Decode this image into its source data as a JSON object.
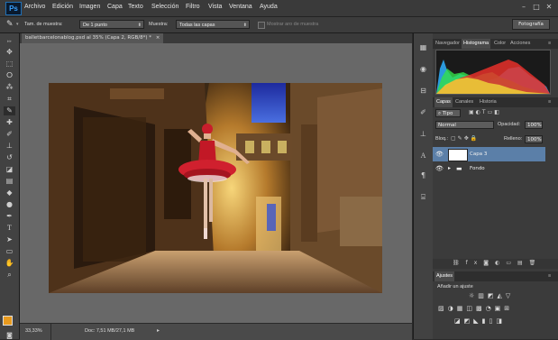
{
  "app": {
    "logo": "Ps"
  },
  "menu": [
    "Archivo",
    "Edición",
    "Imagen",
    "Capa",
    "Texto",
    "Selección",
    "Filtro",
    "Vista",
    "Ventana",
    "Ayuda"
  ],
  "window_controls": {
    "minimize": "–",
    "maximize": "□",
    "close": "✕"
  },
  "options_bar": {
    "sample_size_label": "Tam. de muestra:",
    "sample_size_value": "De 1 punto",
    "sample_label": "Muestra:",
    "sample_value": "Todas las capas",
    "show_ring_label": "Mostrar aro de muestra",
    "workspace": "Fotografía"
  },
  "document": {
    "tab_title": "balletbarcelonablog.psd al 35% (Capa 2, RGB/8*) *",
    "tab_close": "×",
    "zoom": "33,33%",
    "doc_info": "Doc: 7,51 MB/27,1 MB"
  },
  "panels": {
    "top_tabs": [
      "Navegador",
      "Histograma",
      "Color",
      "Acciones"
    ],
    "top_active": "Histograma",
    "layers_tabs": [
      "Capas",
      "Canales",
      "Historia"
    ],
    "layers_active": "Capas",
    "filter_kind": "Tipo",
    "blend_mode": "Normal",
    "opacity_label": "Opacidad:",
    "opacity_value": "100%",
    "lock_label": "Bloq.:",
    "fill_label": "Relleno:",
    "fill_value": "100%",
    "layers": [
      {
        "name": "Capa 3",
        "selected": true
      },
      {
        "name": "Fondo",
        "selected": false
      }
    ],
    "adjust_tab": "Ajustes",
    "adjust_title": "Añadir un ajuste"
  },
  "colors": {
    "ui_dark": "#3b3b3b",
    "selected_layer": "#5b7fa8",
    "foreground_swatch": "#e89a1e",
    "background_swatch": "#000000"
  }
}
